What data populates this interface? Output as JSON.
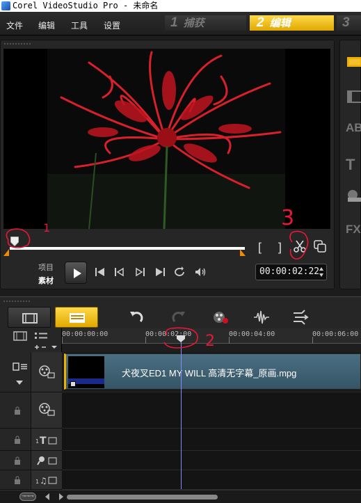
{
  "window": {
    "title": "Corel VideoStudio Pro - 未命名"
  },
  "menu": {
    "items": [
      "文件",
      "编辑",
      "工具",
      "设置"
    ]
  },
  "steps": [
    {
      "num": "1",
      "label": "捕获"
    },
    {
      "num": "2",
      "label": "编辑"
    },
    {
      "num": "3",
      "label": ""
    }
  ],
  "player": {
    "mode_project": "项目",
    "mode_clip": "素材",
    "bracket_in": "[",
    "bracket_out": "]",
    "timecode": "00:00:02:22",
    "scrub_position": 0.0
  },
  "timeline": {
    "ruler_labels": [
      "00:00:00:00",
      "00:00:02:00",
      "00:00:04:00",
      "00:00:06:00"
    ],
    "clip_name": "犬夜叉ED1 MY WILL 高清无字幕_原画.mpg",
    "zoom_label": "⊸⊸⊸"
  },
  "annotations": [
    "1",
    "2",
    "3"
  ],
  "colors": {
    "accent": "#f0b000",
    "annotation": "#e8173a",
    "playhead": "#8a8aff"
  }
}
